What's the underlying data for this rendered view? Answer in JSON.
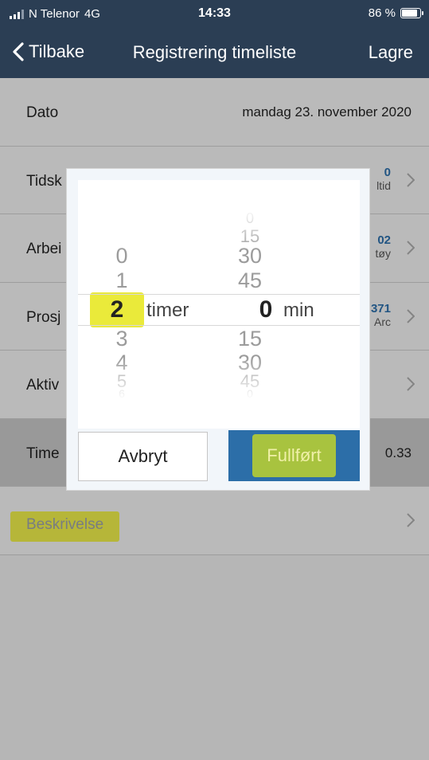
{
  "status": {
    "carrier": "N Telenor",
    "network": "4G",
    "time": "14:33",
    "battery": "86 %"
  },
  "nav": {
    "back": "Tilbake",
    "title": "Registrering timeliste",
    "save": "Lagre"
  },
  "rows": [
    {
      "label": "Dato",
      "value": "mandag 23. november 2020"
    },
    {
      "label": "Tidsk",
      "num": "0",
      "text": "ltid"
    },
    {
      "label": "Arbei",
      "num": "02",
      "text": "tøy"
    },
    {
      "label": "Prosj",
      "num": "371",
      "text": "Arc"
    },
    {
      "label": "Aktiv"
    },
    {
      "label": "Time",
      "value": "0.33"
    },
    {
      "label": "Beskrivelse"
    }
  ],
  "picker": {
    "hours": [
      "0",
      "1",
      "2",
      "3",
      "4",
      "5",
      "6"
    ],
    "hours_selected": "2",
    "hours_unit": "timer",
    "minutes_above": [
      "0",
      "15",
      "30",
      "45"
    ],
    "minutes_selected": "0",
    "minutes_below": [
      "15",
      "30",
      "45",
      "0"
    ],
    "minutes_unit": "min"
  },
  "buttons": {
    "cancel": "Avbryt",
    "done": "Fullført"
  },
  "colors": {
    "bar": "#2b3e54",
    "accent": "#2c6ea8",
    "highlight": "#eaea3a",
    "done_inner": "#a8c33f"
  }
}
